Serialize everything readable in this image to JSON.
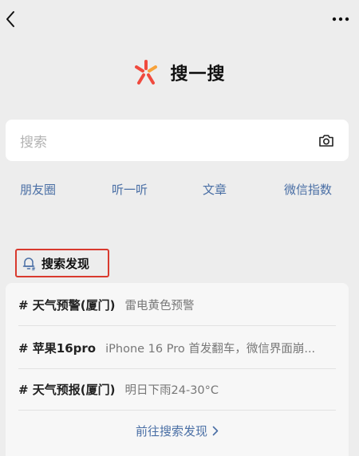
{
  "header": {
    "title": "搜一搜",
    "logo_colors": [
      "#f04a3e",
      "#f7a23b"
    ]
  },
  "search": {
    "placeholder": "搜索"
  },
  "quick_links": [
    "朋友圈",
    "听一听",
    "文章",
    "微信指数"
  ],
  "discover": {
    "title": "搜索发现",
    "topics": [
      {
        "tag": "# 天气预警(厦门)",
        "desc": "雷电黄色预警"
      },
      {
        "tag": "# 苹果16pro",
        "desc": "iPhone 16 Pro 首发翻车，微信界面崩..."
      },
      {
        "tag": "# 天气预报(厦门)",
        "desc": "明日下雨24-30°C"
      }
    ],
    "more_label": "前往搜索发现"
  },
  "colors": {
    "accent_link": "#4a6fa5",
    "highlight_border": "#d93a2e",
    "background": "#ededed"
  }
}
